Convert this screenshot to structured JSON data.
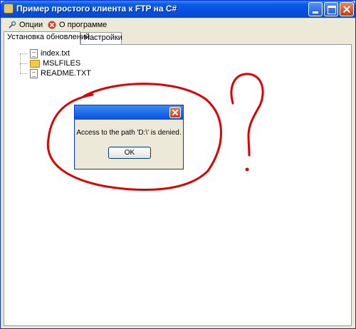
{
  "window": {
    "title": "Пример простого клиента к FTP на C#"
  },
  "menu": [
    {
      "label": "Опции",
      "icon": "wrench-icon"
    },
    {
      "label": "О программе",
      "icon": "help-icon"
    }
  ],
  "tabs": [
    {
      "label": "Установка обновлений",
      "active": true
    },
    {
      "label": "Настройки",
      "active": false
    }
  ],
  "tree": {
    "items": [
      {
        "label": "index.txt",
        "type": "file"
      },
      {
        "label": "MSLFILES",
        "type": "folder"
      },
      {
        "label": "README.TXT",
        "type": "file"
      }
    ]
  },
  "dialog": {
    "message": "Access to the path 'D:\\' is denied.",
    "ok_label": "OK"
  },
  "colors": {
    "title_bar": "#0550e0",
    "annotation": "#e00000"
  }
}
